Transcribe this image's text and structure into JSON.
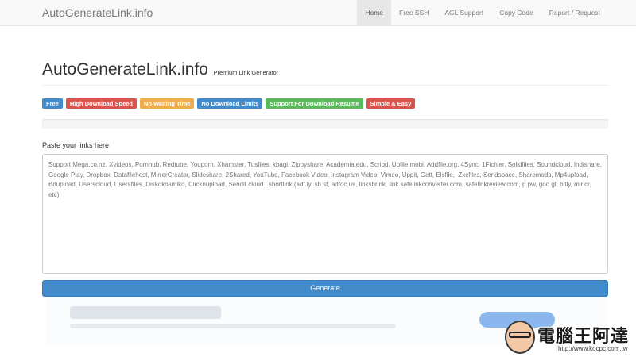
{
  "navbar": {
    "brand": "AutoGenerateLink.info",
    "items": [
      {
        "label": "Home",
        "active": true
      },
      {
        "label": "Free SSH",
        "active": false
      },
      {
        "label": "AGL Support",
        "active": false
      },
      {
        "label": "Copy Code",
        "active": false
      },
      {
        "label": "Report / Request",
        "active": false
      }
    ]
  },
  "header": {
    "title": "AutoGenerateLink.info",
    "subtitle": "Premium Link Generator"
  },
  "labels": [
    {
      "text": "Free",
      "color": "#428bca"
    },
    {
      "text": "High Download Speed",
      "color": "#d9534f"
    },
    {
      "text": "No Waiting Time",
      "color": "#f0ad4e"
    },
    {
      "text": "No Download Limits",
      "color": "#428bca"
    },
    {
      "text": "Support For Download Resume",
      "color": "#5cb85c"
    },
    {
      "text": "Simple & Easy",
      "color": "#d9534f"
    }
  ],
  "form": {
    "paste_label": "Paste your links here",
    "links_placeholder": "Support Mega.co.nz, Xvideos, Pornhub, Redtube, Youporn, Xhamster, Tusfiles, kbagi, Zippyshare, Academia.edu, Scribd, Upfile.mobi, Addfile.org, 4Sync, 1Fichier, Solidfiles, Soundcloud, Indishare, Google Play, Dropbox, Datafilehost, MirrorCreator, Slideshare, 2Shared, YouTube, Facebook Video, Instagram Video, Vimeo, Uppit, Gett, Elsfile,  Zxcfiles, Sendspace, Sharemods, Mp4upload, Bdupload, Userscloud, Usersfiles, Diskokosmiko, Clicknupload, Sendit.cloud | shortlink (adf.ly, sh.st, adfoc.us, linkshrink, link.safelinkconverter.com, safelinkreview.com, p.pw, goo.gl, bitly, mir.cr, etc)",
    "links_value": "",
    "generate_label": "Generate"
  },
  "colors": {
    "primary": "#428bca",
    "navbar_bg": "#f8f8f8"
  },
  "watermark": {
    "text": "電腦王阿達",
    "url": "http://www.kocpc.com.tw"
  }
}
